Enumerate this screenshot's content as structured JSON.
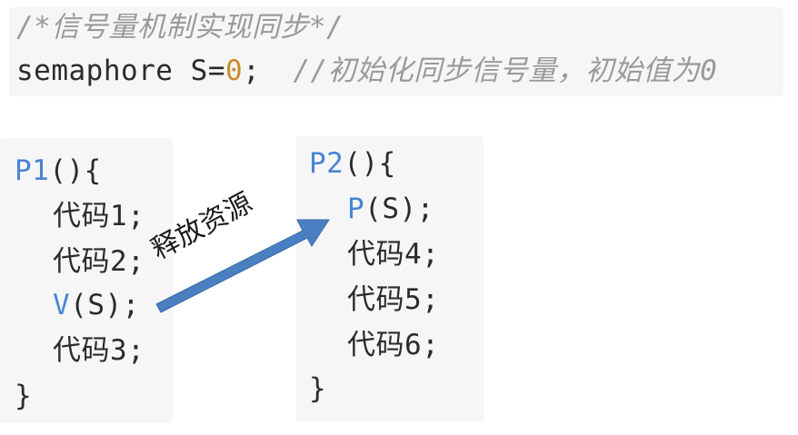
{
  "top": {
    "comment_title": "/*信号量机制实现同步*/",
    "decl_type": "semaphore ",
    "decl_var": "S",
    "decl_eq": "=",
    "decl_value": "0",
    "decl_semicolon": ";",
    "decl_comment": "//初始化同步信号量，初始值为0"
  },
  "p1": {
    "header_name": "P1",
    "header_rest": "(){",
    "line1": "代码1;",
    "line2": "代码2;",
    "op_name": "V",
    "op_args": "(S);",
    "line3": "代码3;",
    "close": "}"
  },
  "p2": {
    "header_name": "P2",
    "header_rest": "(){",
    "op_name": "P",
    "op_args": "(S);",
    "line4": "代码4;",
    "line5": "代码5;",
    "line6": "代码6;",
    "close": "}"
  },
  "arrow": {
    "label": "释放资源",
    "color": "#4a7fc1"
  }
}
